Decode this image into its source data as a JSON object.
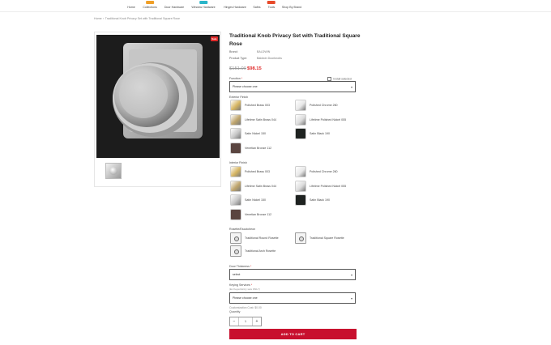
{
  "colors": {
    "accent": "#c8102e",
    "sale": "#e02b2b",
    "polished_brass": "#d6b562",
    "polished_chrome": "#e8e8e8",
    "lifetime_satin_brass": "#bfa56d",
    "lifetime_polished_nickel": "#dcdcdc",
    "satin_nickel": "#c7c7c7",
    "satin_black": "#1e2220",
    "venetian_bronze": "#5a4540"
  },
  "nav": {
    "items": [
      {
        "label": "Home"
      },
      {
        "label": "Collections",
        "badge": "",
        "badge_color": "#f0a028"
      },
      {
        "label": "Door Hardware"
      },
      {
        "label": "Window Hardware",
        "badge": "",
        "badge_color": "#2bb5c9"
      },
      {
        "label": "Hinges Hardware"
      },
      {
        "label": "Safes"
      },
      {
        "label": "Tools",
        "badge": "",
        "badge_color": "#e84a2a"
      },
      {
        "label": "Shop By Brand"
      }
    ]
  },
  "breadcrumb": {
    "home": "Home",
    "separator": "›",
    "current": "Traditional Knob Privacy Set with Traditional Square Rose"
  },
  "gallery": {
    "sale_badge": "Sale"
  },
  "product": {
    "title": "Traditional Knob Privacy Set with Traditional Square Rose",
    "brand_label": "Brand:",
    "brand_value": "BALDWIN",
    "type_label": "Product Type:",
    "type_value": "Baldwin Doorknobs",
    "price_old": "$151.00",
    "price_new": "$98.15"
  },
  "options": {
    "function_label": "Function",
    "function_req": "*",
    "function_placeholder": "Please choose one",
    "function_check": "Install selected",
    "exterior_label": "Exterior Finish",
    "interior_label": "Interior Finish",
    "finishes": [
      {
        "label": "Polished Brass 003",
        "color": "#d6b562"
      },
      {
        "label": "Polished Chrome 260",
        "color": "#e8e8e8"
      },
      {
        "label": "Lifetime Satin Brass 044",
        "color": "#bfa56d"
      },
      {
        "label": "Lifetime Polished Nickel 055",
        "color": "#dcdcdc"
      },
      {
        "label": "Satin Nickel 150",
        "color": "#c7c7c7"
      },
      {
        "label": "Satin Black 190",
        "color": "#1e2220"
      },
      {
        "label": "Venetian Bronze 112",
        "color": "#5a4540"
      }
    ],
    "rosette_label": "Rosette/Escutcheon",
    "rosettes": [
      {
        "label": "Traditional Round Rosette"
      },
      {
        "label": "Traditional Square Rosette"
      },
      {
        "label": "Traditional Arch Rosette"
      }
    ],
    "door_label": "Door Thickness",
    "door_req": "*",
    "door_value": "select",
    "keying_label": "Keying Services",
    "keying_req": "*",
    "keying_sub": "(Ex Keyed Entry sets ONLY)",
    "keying_placeholder": "Please choose one",
    "customization": "Customization Cost: $0.00",
    "quantity_label": "Quantity",
    "quantity_value": "1",
    "minus": "−",
    "plus": "+",
    "add_to_cart": "ADD TO CART"
  }
}
